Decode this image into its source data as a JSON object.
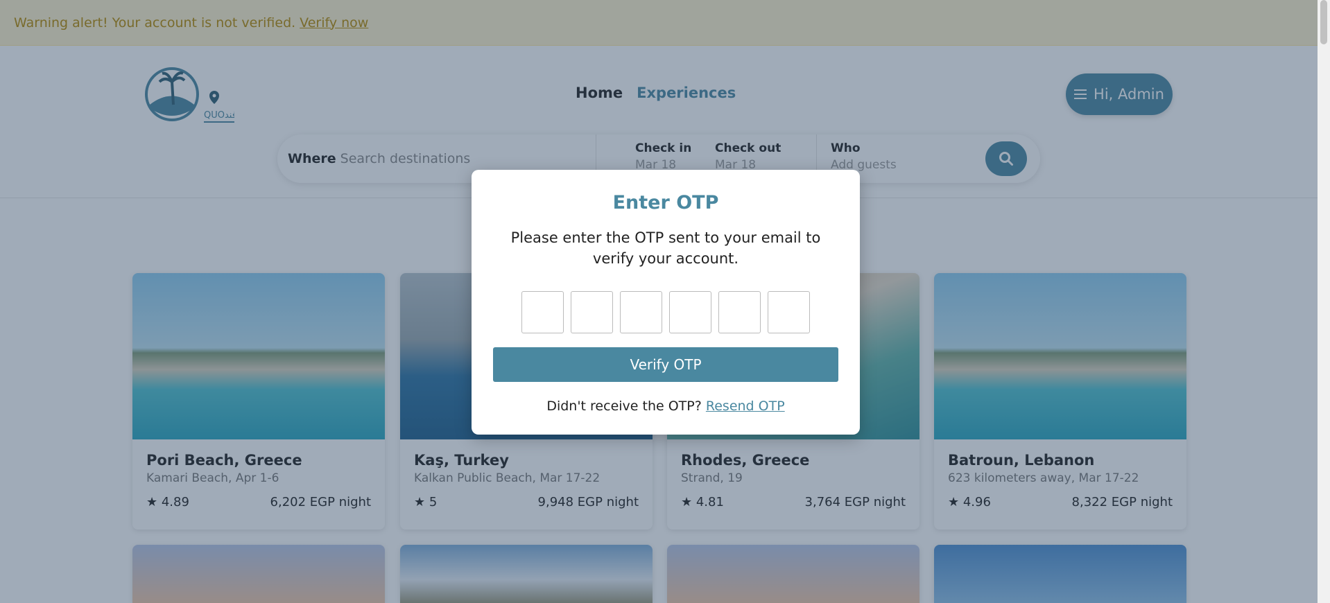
{
  "alert": {
    "text": "Warning alert! Your account is not verified.",
    "link": "Verify now"
  },
  "logo": {
    "text": "QUOفند",
    "icon": "palm-island-pin-logo"
  },
  "nav": {
    "home": "Home",
    "experiences": "Experiences"
  },
  "user_menu": {
    "label": "Hi, Admin",
    "icon": "hamburger-icon"
  },
  "search": {
    "where_label": "Where",
    "where_placeholder": "Search destinations",
    "checkin_label": "Check in",
    "checkin_value": "Mar 18",
    "checkout_label": "Check out",
    "checkout_value": "Mar 18",
    "who_label": "Who",
    "who_placeholder": "Add guests",
    "button_icon": "search-icon"
  },
  "listings": [
    {
      "title": "Pori Beach, Greece",
      "subtitle": "Kamari Beach, Apr 1-6",
      "rating": "★ 4.89",
      "price": "6,202 EGP night"
    },
    {
      "title": "Kaş, Turkey",
      "subtitle": "Kalkan Public Beach, Mar 17-22",
      "rating": "★ 5",
      "price": "9,948 EGP night"
    },
    {
      "title": "Rhodes, Greece",
      "subtitle": "Strand, 19",
      "rating": "★ 4.81",
      "price": "3,764 EGP night"
    },
    {
      "title": "Batroun, Lebanon",
      "subtitle": "623 kilometers away, Mar 17-22",
      "rating": "★ 4.96",
      "price": "8,322 EGP night"
    }
  ],
  "modal": {
    "title": "Enter OTP",
    "description": "Please enter the OTP sent to your email to verify your account.",
    "otp_digits": 6,
    "verify_label": "Verify OTP",
    "resend_prompt": "Didn't receive the OTP?",
    "resend_link": "Resend OTP"
  },
  "colors": {
    "accent": "#4a88a0",
    "alert_bg": "#fff3cd",
    "alert_text": "#b88a00",
    "overlay": "#2c4562"
  }
}
